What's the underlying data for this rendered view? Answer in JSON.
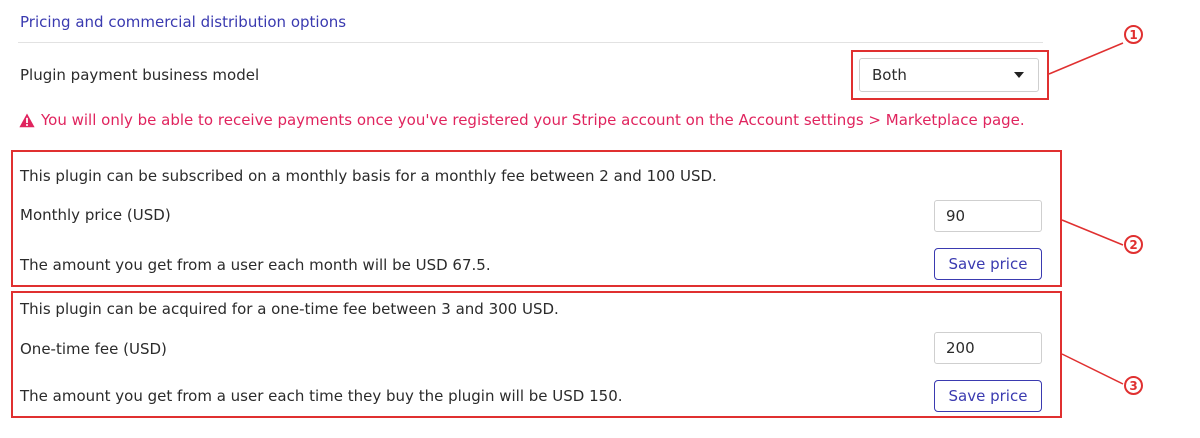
{
  "section": {
    "title": "Pricing and commercial distribution options"
  },
  "business_model": {
    "label": "Plugin payment business model",
    "selected": "Both"
  },
  "warning": {
    "text": "You will only be able to receive payments once you've registered your Stripe account on the Account settings > Marketplace page.",
    "icon": "warning-triangle-icon",
    "color": "#e0245e"
  },
  "monthly": {
    "description": "This plugin can be subscribed on a monthly basis for a monthly fee between 2 and 100 USD.",
    "price_label": "Monthly price (USD)",
    "price_value": "90",
    "earnings": "The amount you get from a user each month will be USD 67.5.",
    "save_label": "Save price"
  },
  "onetime": {
    "description": "This plugin can be acquired for a one-time fee between 3 and 300 USD.",
    "price_label": "One-time fee (USD)",
    "price_value": "200",
    "earnings": "The amount you get from a user each time they buy the plugin will be USD 150.",
    "save_label": "Save price"
  },
  "annotations": {
    "callouts": [
      "1",
      "2",
      "3"
    ],
    "color": "#e03030"
  },
  "colors": {
    "accent": "#3a3ab0",
    "text": "#2b2b2b"
  }
}
